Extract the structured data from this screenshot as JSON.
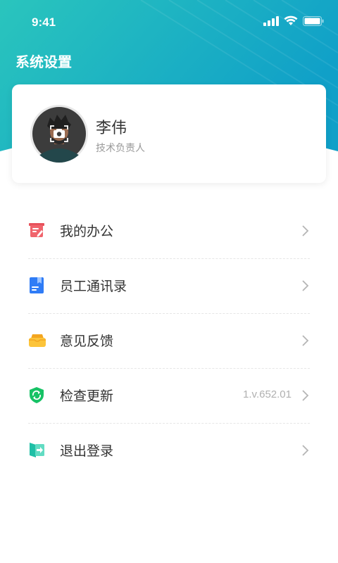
{
  "status_bar": {
    "time": "9:41"
  },
  "header": {
    "title": "系统设置"
  },
  "profile": {
    "name": "李伟",
    "role": "技术负责人"
  },
  "menu": [
    {
      "label": "我的办公",
      "icon": "office-icon",
      "value": ""
    },
    {
      "label": "员工通讯录",
      "icon": "contacts-icon",
      "value": ""
    },
    {
      "label": "意见反馈",
      "icon": "feedback-icon",
      "value": ""
    },
    {
      "label": "检查更新",
      "icon": "update-icon",
      "value": "1.v.652.01"
    },
    {
      "label": "退出登录",
      "icon": "logout-icon",
      "value": ""
    }
  ],
  "colors": {
    "header_start": "#28c3c0",
    "header_end": "#12a1c7",
    "text": "#333333",
    "muted": "#999999"
  }
}
